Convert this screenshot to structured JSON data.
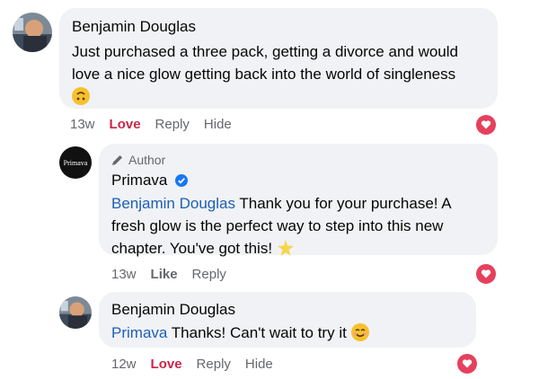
{
  "comments": [
    {
      "author": "Benjamin Douglas",
      "text": "Just purchased a three pack, getting a divorce and would love a nice glow getting back into the world of singleness",
      "emoji": "upside-down-face",
      "time": "13w",
      "reaction_label": "Love",
      "reply_label": "Reply",
      "hide_label": "Hide"
    },
    {
      "badge": "Author",
      "author": "Primava",
      "avatar_text": "Primava",
      "mention": "Benjamin Douglas",
      "text": "Thank you for your purchase! A fresh glow is the perfect way to step into this new chapter. You've got this!",
      "emoji": "glowing-star",
      "time": "13w",
      "reaction_label": "Like",
      "reply_label": "Reply"
    },
    {
      "author": "Benjamin Douglas",
      "mention": "Primava",
      "text": "Thanks! Can't wait to try it",
      "emoji": "smiling-face",
      "time": "12w",
      "reaction_label": "Love",
      "reply_label": "Reply",
      "hide_label": "Hide"
    }
  ],
  "colors": {
    "bubble": "#f0f2f5",
    "mention": "#1d5fb8",
    "love": "#c8264a",
    "heart": "#e5405d",
    "verified": "#1877f2"
  }
}
